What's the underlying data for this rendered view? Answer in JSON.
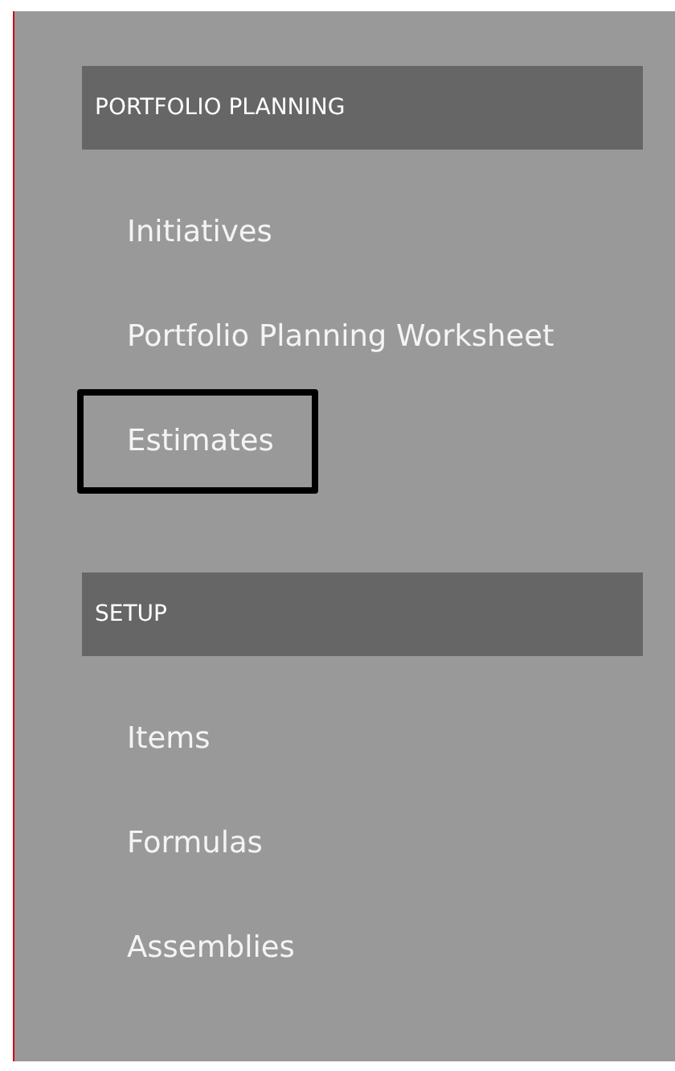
{
  "sections": [
    {
      "title": "PORTFOLIO PLANNING",
      "items": [
        {
          "label": "Initiatives",
          "focused": false
        },
        {
          "label": "Portfolio Planning Worksheet",
          "focused": false
        },
        {
          "label": "Estimates",
          "focused": true
        }
      ]
    },
    {
      "title": "SETUP",
      "items": [
        {
          "label": "Items",
          "focused": false
        },
        {
          "label": "Formulas",
          "focused": false
        },
        {
          "label": "Assemblies",
          "focused": false
        }
      ]
    }
  ]
}
